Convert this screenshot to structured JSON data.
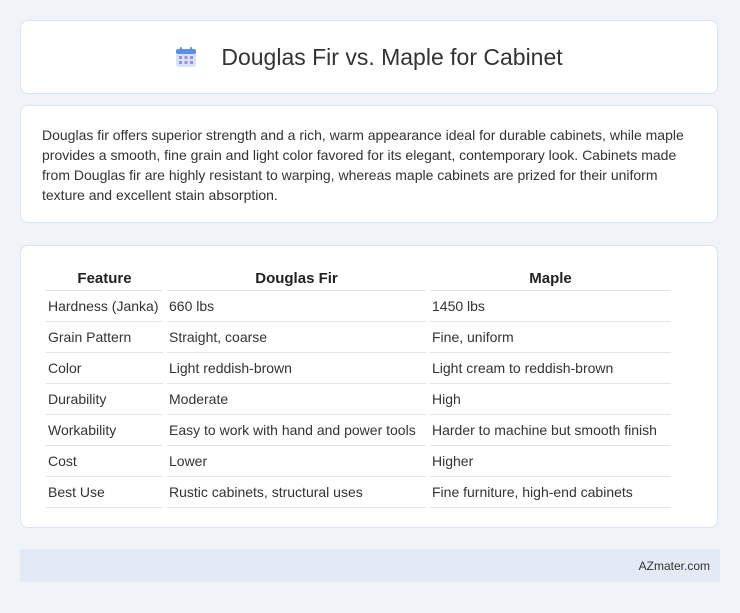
{
  "header": {
    "title": "Douglas Fir vs. Maple for Cabinet",
    "icon": "calendar-icon",
    "icon_colors": {
      "top": "#5b8def",
      "body": "#c9d7f5",
      "dots": "#8a7fd6"
    }
  },
  "summary": {
    "text": "Douglas fir offers superior strength and a rich, warm appearance ideal for durable cabinets, while maple provides a smooth, fine grain and light color favored for its elegant, contemporary look. Cabinets made from Douglas fir are highly resistant to warping, whereas maple cabinets are prized for their uniform texture and excellent stain absorption."
  },
  "table": {
    "headers": [
      "Feature",
      "Douglas Fir",
      "Maple"
    ],
    "rows": [
      [
        "Hardness (Janka)",
        "660 lbs",
        "1450 lbs"
      ],
      [
        "Grain Pattern",
        "Straight, coarse",
        "Fine, uniform"
      ],
      [
        "Color",
        "Light reddish-brown",
        "Light cream to reddish-brown"
      ],
      [
        "Durability",
        "Moderate",
        "High"
      ],
      [
        "Workability",
        "Easy to work with hand and power tools",
        "Harder to machine but smooth finish"
      ],
      [
        "Cost",
        "Lower",
        "Higher"
      ],
      [
        "Best Use",
        "Rustic cabinets, structural uses",
        "Fine furniture, high-end cabinets"
      ]
    ]
  },
  "footer": {
    "text": "AZmater.com"
  }
}
